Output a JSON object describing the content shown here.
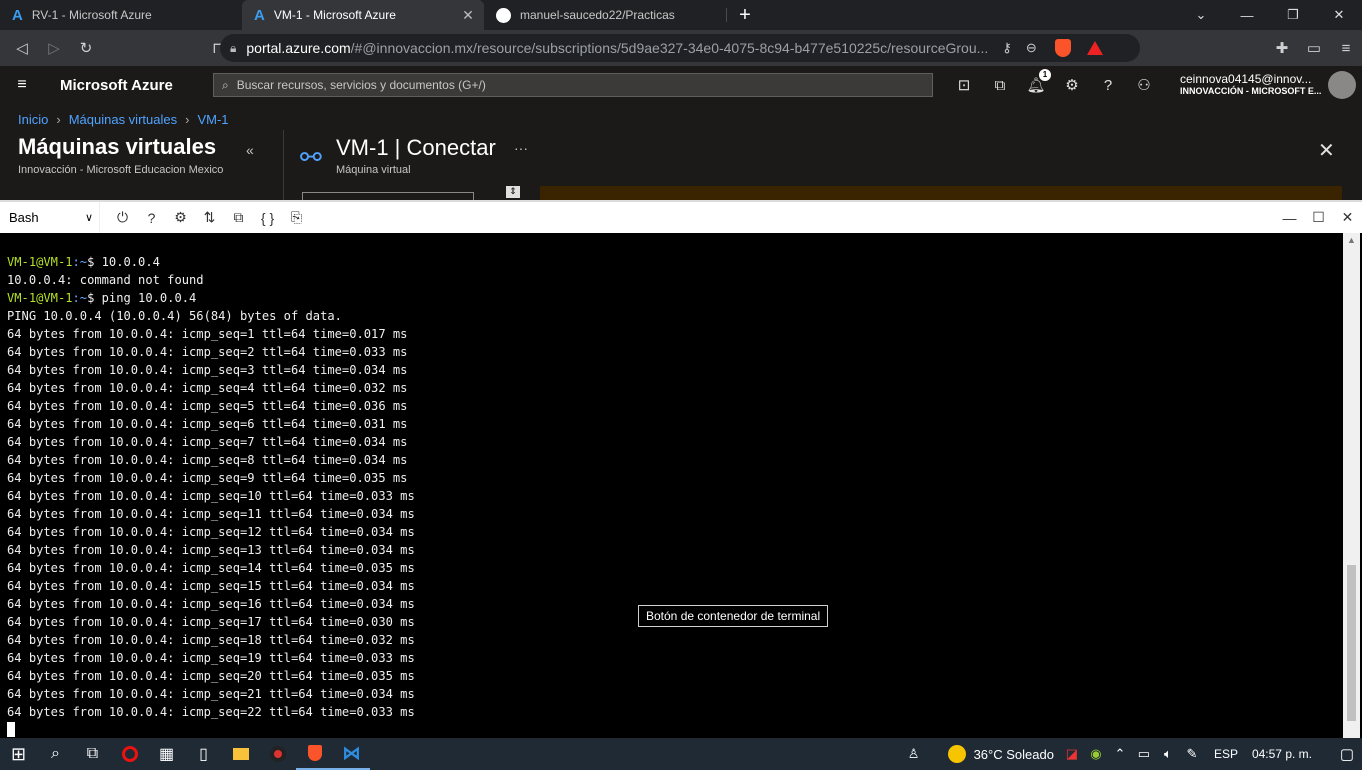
{
  "browser": {
    "tabs": [
      {
        "title": "RV-1 - Microsoft Azure",
        "icon": "azure-logo-icon",
        "active": false
      },
      {
        "title": "VM-1 - Microsoft Azure",
        "icon": "azure-logo-icon",
        "active": true
      },
      {
        "title": "manuel-saucedo22/Practicas",
        "icon": "github-icon",
        "active": false
      }
    ],
    "new_tab": "+",
    "url_host": "portal.azure.com",
    "url_rest": "/#@innovaccion.mx/resource/subscriptions/5d9ae327-34e0-4075-8c94-b477e510225c/resourceGrou...",
    "brave_badge": "1"
  },
  "azure": {
    "brand": "Microsoft Azure",
    "search_placeholder": "Buscar recursos, servicios y documentos (G+/)",
    "notification_count": "1",
    "user_email": "ceinnova04145@innov...",
    "user_org": "INNOVACCIÓN - MICROSOFT E...",
    "breadcrumbs": [
      "Inicio",
      "Máquinas virtuales",
      "VM-1"
    ],
    "left_blade_title": "Máquinas virtuales",
    "left_blade_subtitle": "Innovacción - Microsoft Educacion Mexico",
    "blade_title": "VM-1 | Conectar",
    "blade_subtitle": "Máquina virtual",
    "blade_more": "···"
  },
  "shell": {
    "type": "Bash"
  },
  "terminal": {
    "prompt_user": "VM-1@VM-1",
    "prompt_path": ":~",
    "lines": [
      {
        "prompt": true,
        "text": "$ 10.0.0.4"
      },
      {
        "prompt": false,
        "text": "10.0.0.4: command not found"
      },
      {
        "prompt": true,
        "text": "$ ping 10.0.0.4"
      },
      {
        "prompt": false,
        "text": "PING 10.0.0.4 (10.0.0.4) 56(84) bytes of data."
      },
      {
        "prompt": false,
        "text": "64 bytes from 10.0.0.4: icmp_seq=1 ttl=64 time=0.017 ms"
      },
      {
        "prompt": false,
        "text": "64 bytes from 10.0.0.4: icmp_seq=2 ttl=64 time=0.033 ms"
      },
      {
        "prompt": false,
        "text": "64 bytes from 10.0.0.4: icmp_seq=3 ttl=64 time=0.034 ms"
      },
      {
        "prompt": false,
        "text": "64 bytes from 10.0.0.4: icmp_seq=4 ttl=64 time=0.032 ms"
      },
      {
        "prompt": false,
        "text": "64 bytes from 10.0.0.4: icmp_seq=5 ttl=64 time=0.036 ms"
      },
      {
        "prompt": false,
        "text": "64 bytes from 10.0.0.4: icmp_seq=6 ttl=64 time=0.031 ms"
      },
      {
        "prompt": false,
        "text": "64 bytes from 10.0.0.4: icmp_seq=7 ttl=64 time=0.034 ms"
      },
      {
        "prompt": false,
        "text": "64 bytes from 10.0.0.4: icmp_seq=8 ttl=64 time=0.034 ms"
      },
      {
        "prompt": false,
        "text": "64 bytes from 10.0.0.4: icmp_seq=9 ttl=64 time=0.035 ms"
      },
      {
        "prompt": false,
        "text": "64 bytes from 10.0.0.4: icmp_seq=10 ttl=64 time=0.033 ms"
      },
      {
        "prompt": false,
        "text": "64 bytes from 10.0.0.4: icmp_seq=11 ttl=64 time=0.034 ms"
      },
      {
        "prompt": false,
        "text": "64 bytes from 10.0.0.4: icmp_seq=12 ttl=64 time=0.034 ms"
      },
      {
        "prompt": false,
        "text": "64 bytes from 10.0.0.4: icmp_seq=13 ttl=64 time=0.034 ms"
      },
      {
        "prompt": false,
        "text": "64 bytes from 10.0.0.4: icmp_seq=14 ttl=64 time=0.035 ms"
      },
      {
        "prompt": false,
        "text": "64 bytes from 10.0.0.4: icmp_seq=15 ttl=64 time=0.034 ms"
      },
      {
        "prompt": false,
        "text": "64 bytes from 10.0.0.4: icmp_seq=16 ttl=64 time=0.034 ms"
      },
      {
        "prompt": false,
        "text": "64 bytes from 10.0.0.4: icmp_seq=17 ttl=64 time=0.030 ms"
      },
      {
        "prompt": false,
        "text": "64 bytes from 10.0.0.4: icmp_seq=18 ttl=64 time=0.032 ms"
      },
      {
        "prompt": false,
        "text": "64 bytes from 10.0.0.4: icmp_seq=19 ttl=64 time=0.033 ms"
      },
      {
        "prompt": false,
        "text": "64 bytes from 10.0.0.4: icmp_seq=20 ttl=64 time=0.035 ms"
      },
      {
        "prompt": false,
        "text": "64 bytes from 10.0.0.4: icmp_seq=21 ttl=64 time=0.034 ms"
      },
      {
        "prompt": false,
        "text": "64 bytes from 10.0.0.4: icmp_seq=22 ttl=64 time=0.033 ms"
      }
    ],
    "tooltip": "Botón de contenedor de terminal"
  },
  "taskbar": {
    "weather": "36°C  Soleado",
    "language": "ESP",
    "time": "04:57 p. m."
  },
  "colors": {
    "prompt_user": "#b5e02a",
    "prompt_path": "#6aa6ff",
    "azure_link": "#4fa3ff"
  }
}
